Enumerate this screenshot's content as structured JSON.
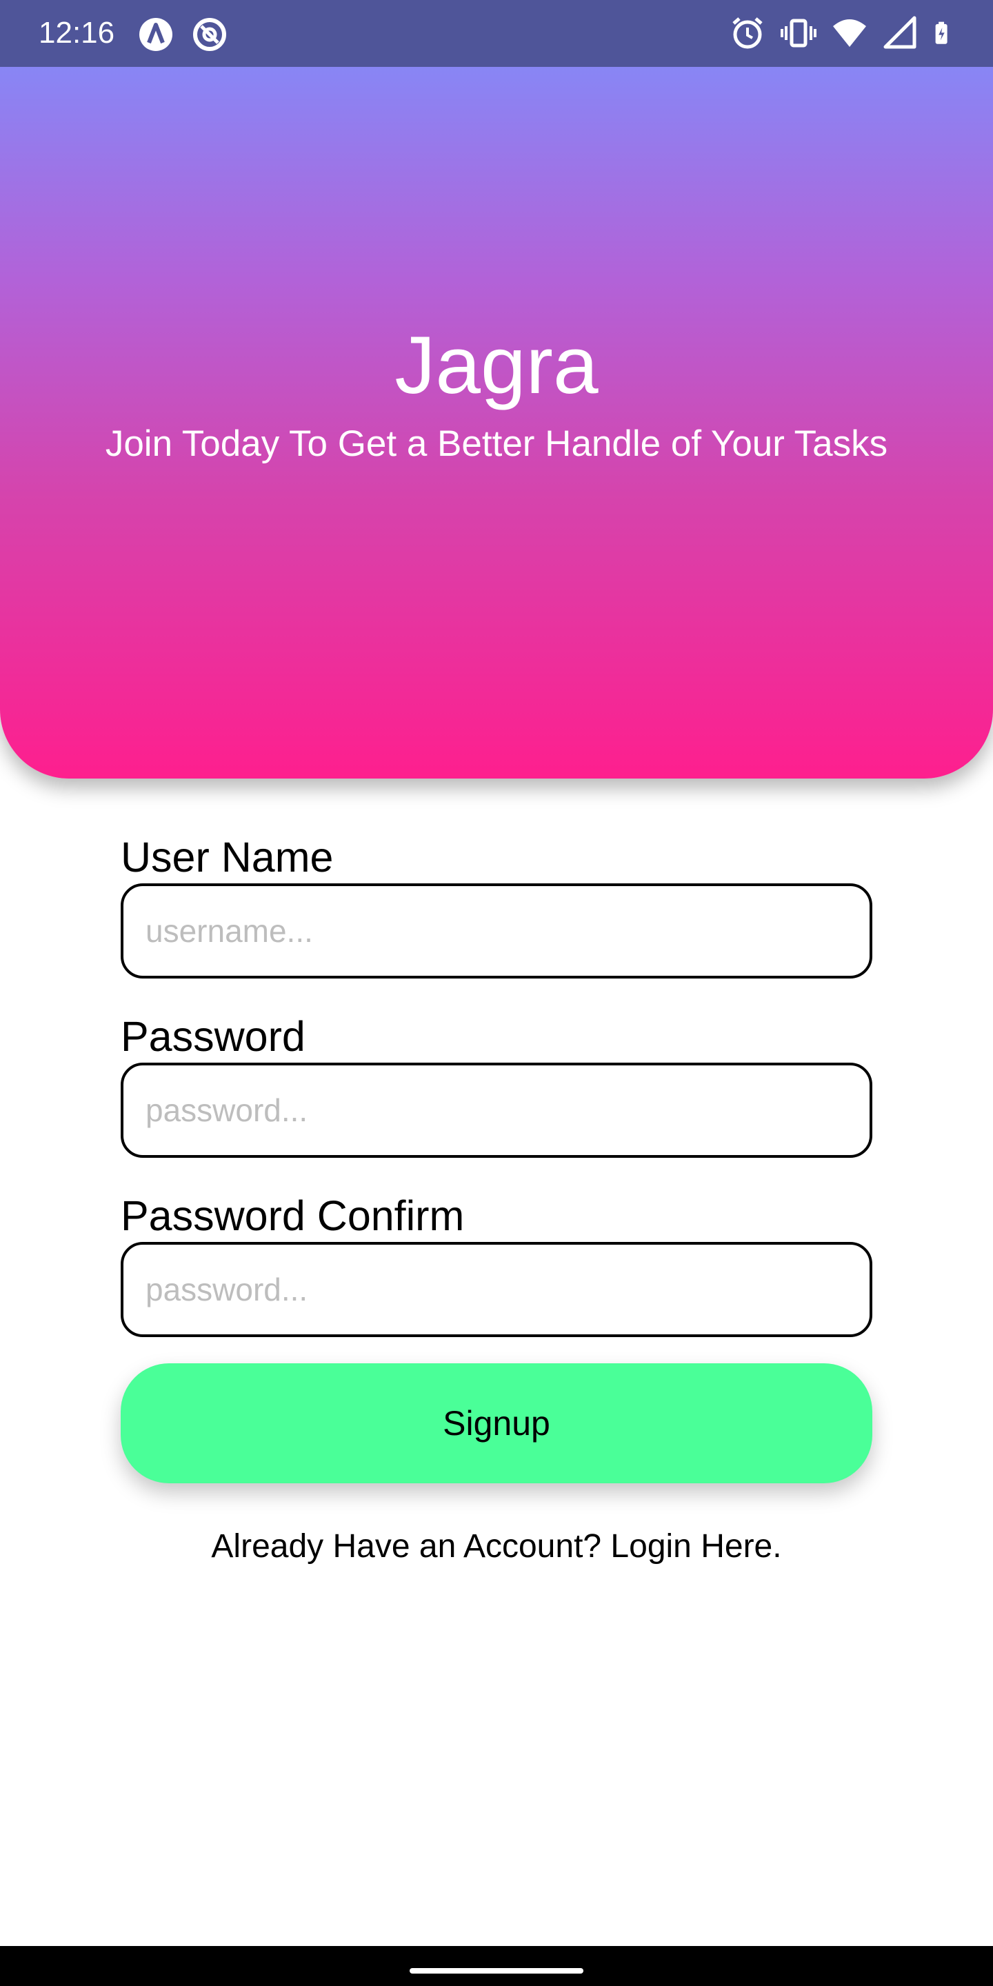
{
  "status_bar": {
    "time": "12:16",
    "left_icons": [
      "app-logo-a-icon",
      "at-sign-icon"
    ],
    "right_icons": [
      "alarm-icon",
      "vibrate-icon",
      "wifi-icon",
      "cellular-signal-icon",
      "battery-charging-icon"
    ]
  },
  "header": {
    "title": "Jagra",
    "subtitle": "Join Today To Get a Better Handle of Your Tasks",
    "gradient_colors": [
      "#8886f5",
      "#b262d8",
      "#d544ad",
      "#fe1f8e"
    ]
  },
  "form": {
    "username": {
      "label": "User Name",
      "placeholder": "username...",
      "value": ""
    },
    "password": {
      "label": "Password",
      "placeholder": "password...",
      "value": ""
    },
    "password_confirm": {
      "label": "Password Confirm",
      "placeholder": "password...",
      "value": ""
    },
    "signup_label": "Signup",
    "signup_color": "#4aff98",
    "login_link": "Already Have an Account? Login Here."
  }
}
